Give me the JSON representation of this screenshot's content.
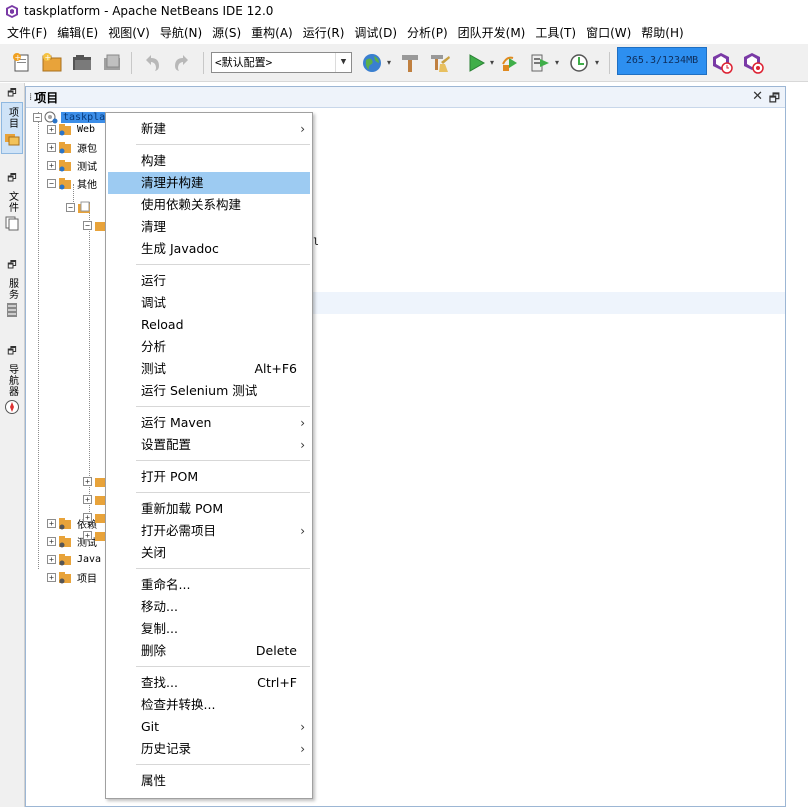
{
  "window": {
    "title": "taskplatform - Apache NetBeans IDE 12.0",
    "icon": "netbeans-cube-icon"
  },
  "menubar": [
    "文件(F)",
    "编辑(E)",
    "视图(V)",
    "导航(N)",
    "源(S)",
    "重构(A)",
    "运行(R)",
    "调试(D)",
    "分析(P)",
    "团队开发(M)",
    "工具(T)",
    "窗口(W)",
    "帮助(H)"
  ],
  "toolbar": {
    "buttons": [
      "new-file-icon",
      "new-project-icon",
      "open-project-icon",
      "close-project-icon",
      "undo-icon",
      "redo-icon",
      "browser-globe-icon",
      "hammer-build-icon",
      "clean-build-icon",
      "run-icon",
      "debug-icon",
      "profile-icon",
      "attach-icon",
      "gc-icon",
      "snapshot-icon"
    ],
    "config_value": "<默认配置>",
    "memory": "265.3/1234MB"
  },
  "left_strip": [
    {
      "label": "项目",
      "active": true,
      "icon": "projects-icon"
    },
    {
      "label": "文件",
      "active": false,
      "icon": "files-icon"
    },
    {
      "label": "服务",
      "active": false,
      "icon": "services-icon"
    },
    {
      "label": "导航器",
      "active": false,
      "icon": "navigator-icon"
    }
  ],
  "panel": {
    "title": "项目",
    "close": "✕",
    "maximize": "🗗"
  },
  "tree": {
    "root": "taskplatform",
    "items": [
      {
        "label": "Web",
        "icon": "web-pages-icon"
      },
      {
        "label": "源包",
        "icon": "source-package-icon"
      },
      {
        "label": "测试",
        "icon": "test-package-icon"
      },
      {
        "label": "其他",
        "icon": "other-sources-icon"
      },
      {
        "label": "依赖",
        "icon": "dependencies-icon"
      },
      {
        "label": "测试",
        "icon": "test-dependencies-icon"
      },
      {
        "label": "Java",
        "icon": "java-deps-icon"
      },
      {
        "label": "项目",
        "icon": "project-files-icon"
      }
    ],
    "partial_text": "l"
  },
  "context_menu": {
    "items": [
      {
        "label": "新建",
        "submenu": true
      },
      {
        "sep": true
      },
      {
        "label": "构建"
      },
      {
        "label": "清理并构建",
        "highlighted": true
      },
      {
        "label": "使用依赖关系构建"
      },
      {
        "label": "清理"
      },
      {
        "label": "生成 Javadoc"
      },
      {
        "sep": true
      },
      {
        "label": "运行"
      },
      {
        "label": "调试"
      },
      {
        "label": "Reload"
      },
      {
        "label": "分析"
      },
      {
        "label": "测试",
        "shortcut": "Alt+F6"
      },
      {
        "label": "运行 Selenium 测试"
      },
      {
        "sep": true
      },
      {
        "label": "运行 Maven",
        "submenu": true
      },
      {
        "label": "设置配置",
        "submenu": true
      },
      {
        "sep": true
      },
      {
        "label": "打开 POM"
      },
      {
        "sep": true
      },
      {
        "label": "重新加载 POM"
      },
      {
        "label": "打开必需项目",
        "submenu": true
      },
      {
        "label": "关闭"
      },
      {
        "sep": true
      },
      {
        "label": "重命名..."
      },
      {
        "label": "移动..."
      },
      {
        "label": "复制..."
      },
      {
        "label": "删除",
        "shortcut": "Delete"
      },
      {
        "sep": true
      },
      {
        "label": "查找...",
        "shortcut": "Ctrl+F"
      },
      {
        "label": "检查并转换..."
      },
      {
        "label": "Git",
        "submenu": true
      },
      {
        "label": "历史记录",
        "submenu": true
      },
      {
        "sep": true
      },
      {
        "label": "属性"
      }
    ],
    "submenu_arrow": "›"
  }
}
